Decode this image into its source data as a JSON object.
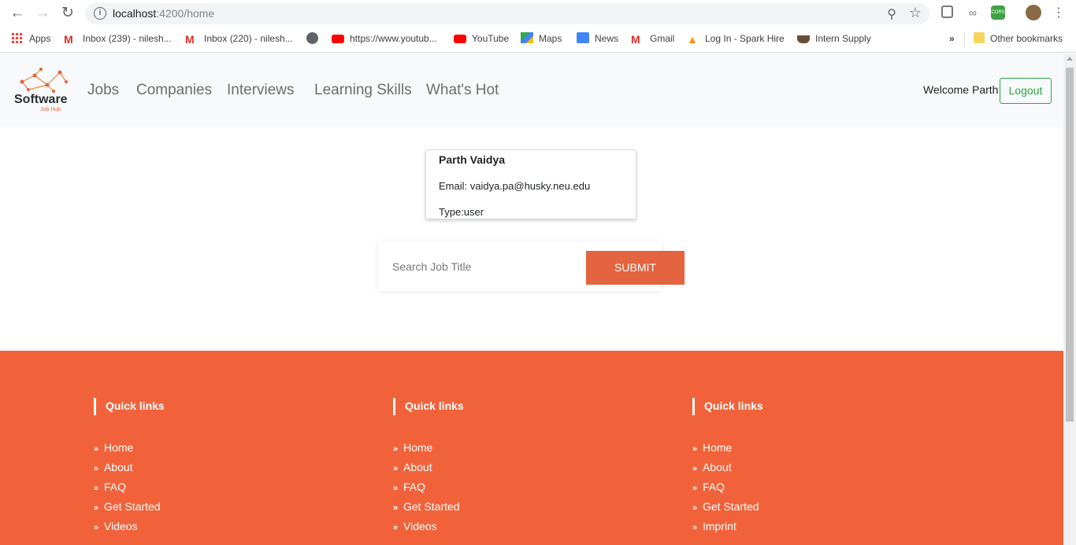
{
  "browser": {
    "url_host": "localhost",
    "url_path": ":4200/home",
    "bookmarks": [
      {
        "label": "Apps",
        "icon": "apps-grid-icon"
      },
      {
        "label": "Inbox (239) - nilesh...",
        "icon": "gmail-icon"
      },
      {
        "label": "Inbox (220) - nilesh...",
        "icon": "gmail-icon"
      },
      {
        "label": "",
        "icon": "globe-icon"
      },
      {
        "label": "https://www.youtub...",
        "icon": "youtube-icon"
      },
      {
        "label": "YouTube",
        "icon": "youtube-icon"
      },
      {
        "label": "Maps",
        "icon": "maps-icon"
      },
      {
        "label": "News",
        "icon": "news-icon"
      },
      {
        "label": "Gmail",
        "icon": "gmail-icon"
      },
      {
        "label": "Log In - Spark Hire",
        "icon": "flame-icon"
      },
      {
        "label": "Intern Supply",
        "icon": "coffee-icon"
      }
    ],
    "overflow": "»",
    "other_bookmarks": "Other bookmarks"
  },
  "navbar": {
    "logo_text": "Software",
    "logo_sub": "Job Hub",
    "links": [
      "Jobs",
      "Companies",
      "Interviews",
      "Learning Skills",
      "What's Hot"
    ],
    "welcome": "Welcome Parth",
    "logout": "Logout"
  },
  "profile": {
    "name": "Parth Vaidya",
    "email": "Email: vaidya.pa@husky.neu.edu",
    "type": "Type:user"
  },
  "search": {
    "placeholder": "Search Job Title",
    "submit": "SUBMIT"
  },
  "footer": {
    "columns": [
      {
        "title": "Quick links",
        "links": [
          "Home",
          "About",
          "FAQ",
          "Get Started",
          "Videos"
        ]
      },
      {
        "title": "Quick links",
        "links": [
          "Home",
          "About",
          "FAQ",
          "Get Started",
          "Videos"
        ]
      },
      {
        "title": "Quick links",
        "links": [
          "Home",
          "About",
          "FAQ",
          "Get Started",
          "Imprint"
        ]
      }
    ]
  },
  "colors": {
    "accent": "#e3643f",
    "footer": "#f2623a",
    "logout": "#28a745"
  }
}
